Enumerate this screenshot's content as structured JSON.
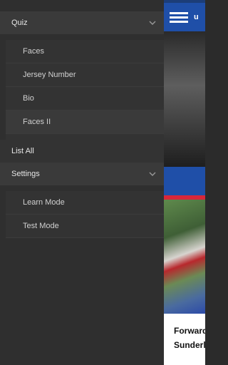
{
  "drawer": {
    "quiz": {
      "label": "Quiz",
      "items": [
        "Faces",
        "Jersey Number",
        "Bio",
        "Faces II"
      ]
    },
    "list_all": "List All",
    "settings": {
      "label": "Settings",
      "items": [
        "Learn Mode",
        "Test Mode"
      ]
    }
  },
  "content": {
    "appbar_title": "u",
    "headline_line1": "Forward",
    "headline_line2": "Sunderl"
  },
  "colors": {
    "accent_blue": "#1f4fa8",
    "accent_red": "#d8273a",
    "drawer_bg": "#2f2f2f"
  }
}
